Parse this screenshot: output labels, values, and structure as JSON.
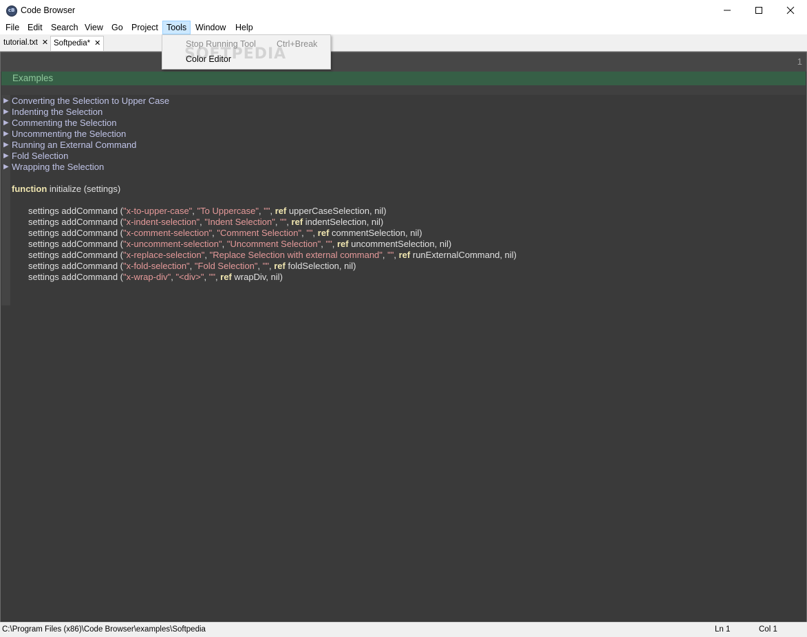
{
  "window": {
    "title": "Code Browser"
  },
  "menu": [
    "File",
    "Edit",
    "Search",
    "View",
    "Go",
    "Project",
    "Tools",
    "Window",
    "Help"
  ],
  "tabs": [
    {
      "label": "tutorial.txt"
    },
    {
      "label": "Softpedia*"
    }
  ],
  "tools_menu": {
    "items": [
      {
        "label": "Stop Running Tool",
        "shortcut": "Ctrl+Break",
        "enabled": false
      },
      {
        "label": "Color Editor",
        "shortcut": "",
        "enabled": true
      }
    ]
  },
  "watermark": "SOFTPEDIA",
  "editor": {
    "line_number": "1",
    "heading": "Examples",
    "folds": [
      "Converting the Selection to Upper Case",
      "Indenting the Selection",
      "Commenting the Selection",
      "Uncommenting the Selection",
      "Running an External Command",
      "Fold Selection",
      "Wrapping the Selection"
    ],
    "function_kw": "function",
    "function_sig": " initialize (settings)",
    "commands": [
      {
        "id": "\"x-to-upper-case\"",
        "name": "\"To Uppercase\"",
        "fn": "upperCaseSelection"
      },
      {
        "id": "\"x-indent-selection\"",
        "name": "\"Indent Selection\"",
        "fn": "indentSelection"
      },
      {
        "id": "\"x-comment-selection\"",
        "name": "\"Comment Selection\"",
        "fn": "commentSelection"
      },
      {
        "id": "\"x-uncomment-selection\"",
        "name": "\"Uncomment Selection\"",
        "fn": "uncommentSelection"
      },
      {
        "id": "\"x-replace-selection\"",
        "name": "\"Replace Selection with external command\"",
        "fn": "runExternalCommand"
      },
      {
        "id": "\"x-fold-selection\"",
        "name": "\"Fold Selection\"",
        "fn": "foldSelection"
      },
      {
        "id": "\"x-wrap-div\"",
        "name": "\"<div>\"",
        "fn": "wrapDiv"
      }
    ],
    "cmd_prefix": "settings addCommand (",
    "empty_str": "\"\"",
    "ref_kw": "ref",
    "nil_suffix": ", nil)"
  },
  "status": {
    "path": "C:\\Program Files (x86)\\Code Browser\\examples\\Softpedia",
    "ln": "Ln 1",
    "col": "Col 1"
  }
}
